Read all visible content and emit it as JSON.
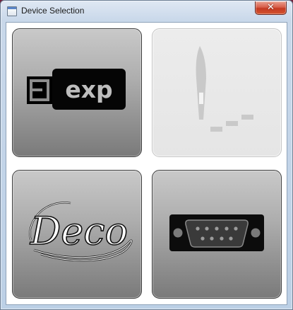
{
  "window": {
    "title": "Device Selection",
    "close_label": "✕"
  },
  "tiles": [
    {
      "id": "exp",
      "label": "exp",
      "enabled": true
    },
    {
      "id": "needle",
      "enabled": false
    },
    {
      "id": "deco",
      "label": "Deco",
      "enabled": true
    },
    {
      "id": "serial",
      "enabled": true
    }
  ],
  "colors": {
    "tile_top": "#c9c9c9",
    "tile_bottom": "#7a7a7a",
    "disabled_tile": "#e8e8e8",
    "close_button": "#c43a22"
  }
}
